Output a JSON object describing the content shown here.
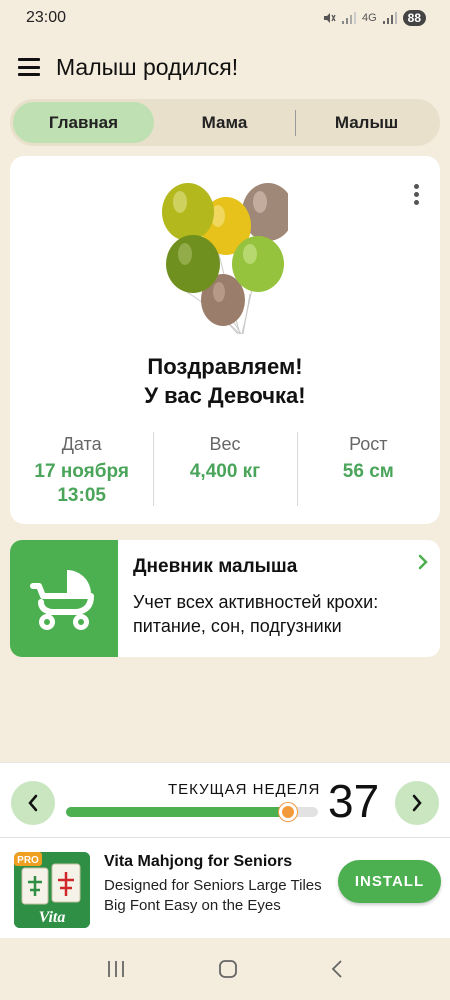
{
  "status_bar": {
    "time": "23:00",
    "network": "4G",
    "battery": "88"
  },
  "app_bar": {
    "title": "Малыш родился!",
    "menu_icon": "menu-icon"
  },
  "tabs": [
    {
      "label": "Главная",
      "active": true
    },
    {
      "label": "Мама",
      "active": false
    },
    {
      "label": "Малыш",
      "active": false
    }
  ],
  "main_card": {
    "congrats_line1": "Поздравляем!",
    "congrats_line2": "У вас Девочка!",
    "stats": [
      {
        "label": "Дата",
        "value": "17 ноября\n13:05"
      },
      {
        "label": "Вес",
        "value": "4,400  кг"
      },
      {
        "label": "Рост",
        "value": "56 см"
      }
    ]
  },
  "diary_card": {
    "title": "Дневник малыша",
    "description": "Учет всех активностей крохи: питание, сон, подгузники"
  },
  "week_panel": {
    "label": "ТЕКУЩАЯ НЕДЕЛЯ",
    "number": "37",
    "progress": 0.88
  },
  "ad": {
    "title": "Vita Mahjong for Seniors",
    "description": "Designed for Seniors Large Tiles Big Font Easy on the Eyes",
    "install_label": "INSTALL",
    "badge": "PRO",
    "logo_text": "Vita"
  },
  "colors": {
    "accent": "#4caf50",
    "value_green": "#4aa55a",
    "background": "#f4ecdc",
    "tab_active": "#bfe0b2",
    "knob": "#f39a3d"
  }
}
